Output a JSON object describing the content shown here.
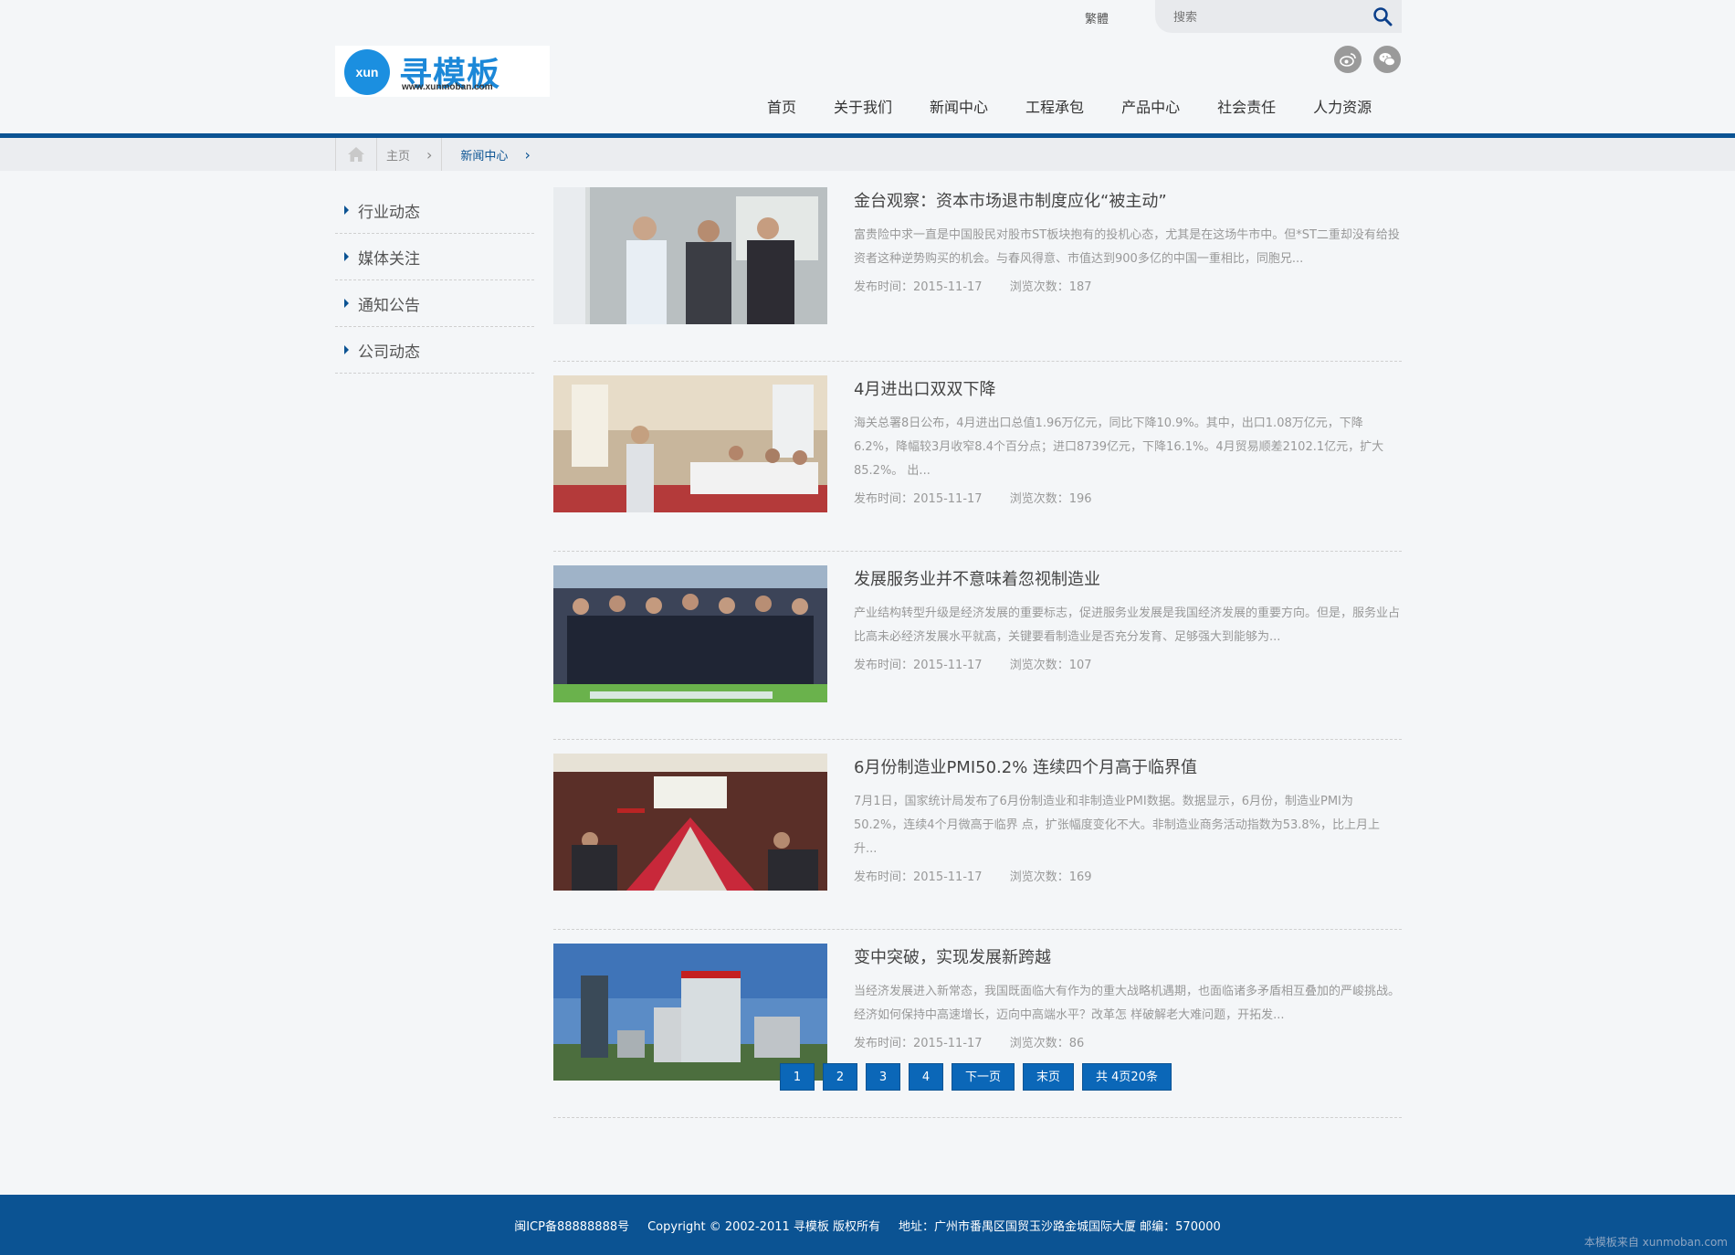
{
  "header": {
    "lang_switch": "繁體",
    "search_placeholder": "搜索",
    "logo_badge": "xun",
    "logo_text": "寻模板",
    "logo_url": "www.xunmoban.com",
    "nav": [
      "首页",
      "关于我们",
      "新闻中心",
      "工程承包",
      "产品中心",
      "社会责任",
      "人力资源"
    ]
  },
  "breadcrumb": {
    "home": "主页",
    "current": "新闻中心"
  },
  "sidebar": {
    "items": [
      "行业动态",
      "媒体关注",
      "通知公告",
      "公司动态"
    ]
  },
  "news": [
    {
      "title": "金台观察：资本市场退市制度应化“被主动”",
      "desc": "富贵险中求一直是中国股民对股市ST板块抱有的投机心态，尤其是在这场牛市中。但*ST二重却没有给投资者这种逆势购买的机会。与春风得意、市值达到900多亿的中国一重相比，同胞兄...",
      "date": "发布时间：2015-11-17",
      "views": "浏览次数：187"
    },
    {
      "title": "4月进出口双双下降",
      "desc": "海关总署8日公布，4月进出口总值1.96万亿元，同比下降10.9%。其中，出口1.08万亿元，下降6.2%，降幅较3月收窄8.4个百分点；进口8739亿元，下降16.1%。4月贸易顺差2102.1亿元，扩大85.2%。 出...",
      "date": "发布时间：2015-11-17",
      "views": "浏览次数：196"
    },
    {
      "title": "发展服务业并不意味着忽视制造业",
      "desc": "产业结构转型升级是经济发展的重要标志，促进服务业发展是我国经济发展的重要方向。但是，服务业占比高未必经济发展水平就高，关键要看制造业是否充分发育、足够强大到能够为...",
      "date": "发布时间：2015-11-17",
      "views": "浏览次数：107"
    },
    {
      "title": "6月份制造业PMI50.2% 连续四个月高于临界值",
      "desc": "7月1日，国家统计局发布了6月份制造业和非制造业PMI数据。数据显示，6月份，制造业PMI为50.2%，连续4个月微高于临界 点，扩张幅度变化不大。非制造业商务活动指数为53.8%，比上月上升...",
      "date": "发布时间：2015-11-17",
      "views": "浏览次数：169"
    },
    {
      "title": "变中突破，实现发展新跨越",
      "desc": "当经济发展进入新常态，我国既面临大有作为的重大战略机遇期，也面临诸多矛盾相互叠加的严峻挑战。经济如何保持中高速增长，迈向中高端水平？改革怎 样破解老大难问题，开拓发...",
      "date": "发布时间：2015-11-17",
      "views": "浏览次数：86"
    }
  ],
  "pager": {
    "pages": [
      "1",
      "2",
      "3",
      "4"
    ],
    "next": "下一页",
    "last": "末页",
    "total": "共 4页20条"
  },
  "footer": {
    "icp": "闽ICP备88888888号",
    "copyright": "Copyright © 2002-2011 寻模板 版权所有",
    "address": "地址：广州市番禺区国贸玉沙路金城国际大厦 邮编：570000",
    "watermark": "本模板来自 xunmoban.com"
  },
  "colors": {
    "primary": "#0b5393",
    "button": "#0b67b8",
    "logo": "#1c88d8"
  }
}
